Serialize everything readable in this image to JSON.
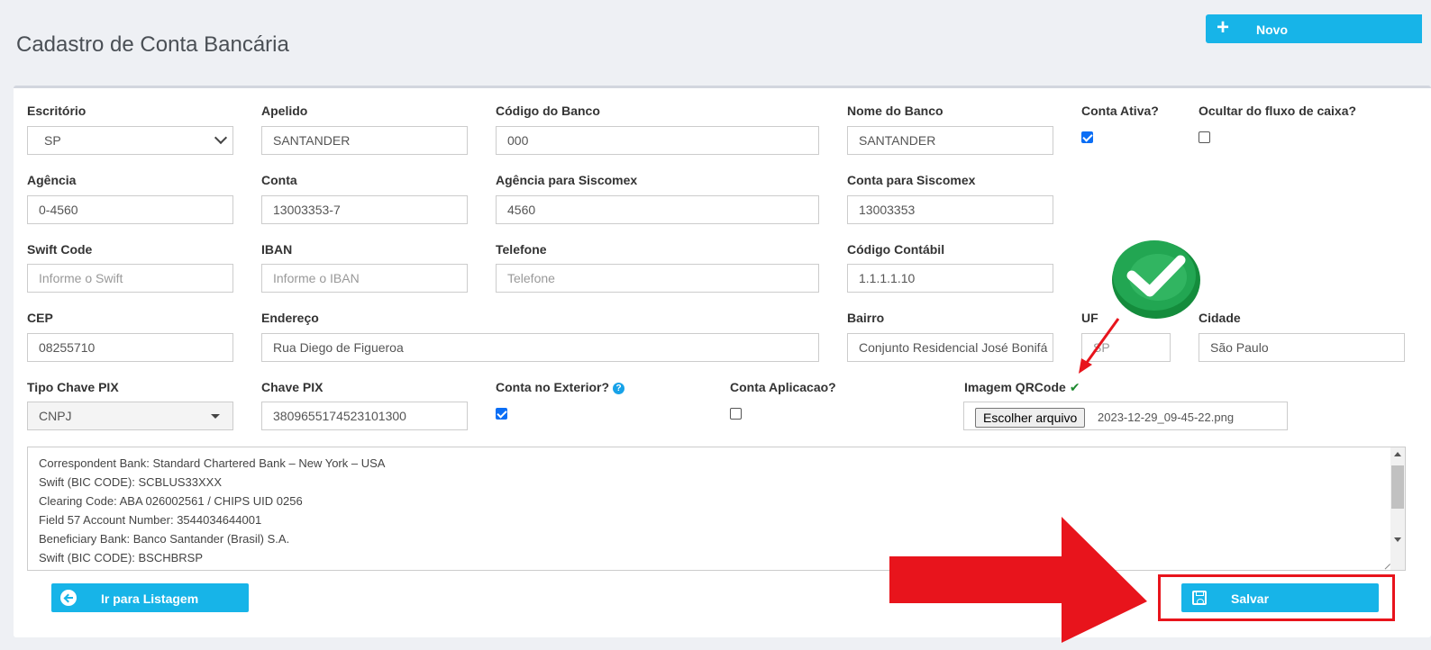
{
  "header": {
    "title": "Cadastro de Conta Bancária",
    "new_button": "Novo"
  },
  "form": {
    "escritorio": {
      "label": "Escritório",
      "value": "SP"
    },
    "apelido": {
      "label": "Apelido",
      "value": "SANTANDER"
    },
    "codigo_banco": {
      "label": "Código do Banco",
      "value": "000"
    },
    "nome_banco": {
      "label": "Nome do Banco",
      "value": "SANTANDER"
    },
    "conta_ativa": {
      "label": "Conta Ativa?",
      "checked": true
    },
    "ocultar_fluxo": {
      "label": "Ocultar do fluxo de caixa?",
      "checked": false
    },
    "agencia": {
      "label": "Agência",
      "value": "0-4560"
    },
    "conta": {
      "label": "Conta",
      "value": "13003353-7"
    },
    "agencia_siscomex": {
      "label": "Agência para Siscomex",
      "value": "4560"
    },
    "conta_siscomex": {
      "label": "Conta para Siscomex",
      "value": "13003353"
    },
    "swift": {
      "label": "Swift Code",
      "placeholder": "Informe o Swift"
    },
    "iban": {
      "label": "IBAN",
      "placeholder": "Informe o IBAN"
    },
    "telefone": {
      "label": "Telefone",
      "placeholder": "Telefone"
    },
    "codigo_contabil": {
      "label": "Código Contábil",
      "value": "1.1.1.1.10"
    },
    "cep": {
      "label": "CEP",
      "value": "08255710"
    },
    "endereco": {
      "label": "Endereço",
      "value": "Rua Diego de Figueroa"
    },
    "bairro": {
      "label": "Bairro",
      "value": "Conjunto Residencial José Bonifá"
    },
    "uf": {
      "label": "UF",
      "value": "SP"
    },
    "cidade": {
      "label": "Cidade",
      "value": "São Paulo"
    },
    "tipo_chave_pix": {
      "label": "Tipo Chave PIX",
      "value": "CNPJ"
    },
    "chave_pix": {
      "label": "Chave PIX",
      "value": "3809655174523101300"
    },
    "conta_exterior": {
      "label": "Conta no Exterior?",
      "checked": true,
      "help_icon": "?"
    },
    "conta_aplicacao": {
      "label": "Conta Aplicacao?",
      "checked": false
    },
    "imagem_qrcode": {
      "label": "Imagem QRCode",
      "ok_icon": "✔",
      "button": "Escolher arquivo",
      "filename": "2023-12-29_09-45-22.png"
    },
    "observacoes": [
      "Correspondent Bank: Standard Chartered Bank – New York – USA",
      "Swift (BIC CODE): SCBLUS33XXX",
      "Clearing Code: ABA 026002561 / CHIPS UID 0256",
      "Field 57 Account Number: 3544034644001",
      "Beneficiary Bank: Banco Santander (Brasil) S.A.",
      "Swift (BIC CODE): BSCHBRSP"
    ]
  },
  "actions": {
    "back_button": "Ir para Listagem",
    "save_button": "Salvar"
  },
  "colors": {
    "primary": "#17b4e8",
    "annotation_red": "#e8141c",
    "check_green": "#1d8a2f",
    "badge_green": "#16a34a"
  }
}
